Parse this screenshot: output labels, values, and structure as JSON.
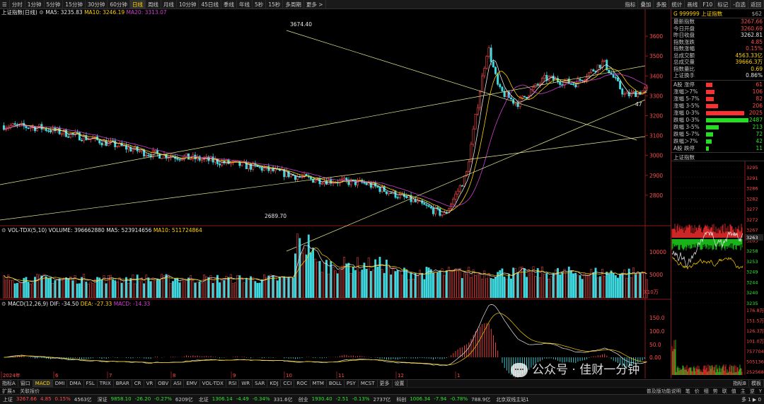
{
  "toolbar": {
    "left_items": [
      "分时",
      "1分钟",
      "5分钟",
      "15分钟",
      "30分钟",
      "60分钟",
      "日线",
      "周线",
      "月线",
      "10分钟",
      "45日线",
      "季线",
      "年线",
      "5秒",
      "15秒",
      "多周期",
      "更多 >"
    ],
    "active_index": 6,
    "right_items": [
      "指标",
      "叠加",
      "多股",
      "统计",
      "画线",
      "F10",
      "标记",
      "-自选",
      "返回"
    ]
  },
  "main_chart": {
    "title": "上证指数(日线)",
    "ma_labels": [
      {
        "text": "MA5: 3235.83",
        "color": "#e8e8e8"
      },
      {
        "text": "MA10: 3246.19",
        "color": "#ffd200"
      },
      {
        "text": "MA20: 3313.07",
        "color": "#d040d0"
      }
    ],
    "price_ticks": [
      "3600",
      "3500",
      "3400",
      "3300",
      "3200",
      "3100",
      "3000",
      "2900",
      "2800"
    ],
    "high_label": "3674.40",
    "low_label": "2689.70",
    "note_label": "47",
    "candles_up_color": "#ff4a4a",
    "candles_down_color": "#3fd9e0"
  },
  "volume_panel": {
    "title": "VOL-TDX(5,10)",
    "volume": "VOLUME: 396662880",
    "ma5": "MA5: 523914656",
    "ma10": "MA10: 511724864",
    "ticks": [
      "10000",
      "5000"
    ],
    "unit": "X10万"
  },
  "macd_panel": {
    "title": "MACD(12,26,9)",
    "dif": "DIF: -34.50",
    "dea": "DEA: -27.33",
    "macd": "MACD: -14.33",
    "ticks": [
      "150.0",
      "100.0",
      "50.0",
      "0.00"
    ],
    "months": [
      "2024年",
      "6",
      "7",
      "8",
      "9",
      "10",
      "11",
      "12",
      "1",
      "2"
    ]
  },
  "right_panel": {
    "header_code": "G 999999",
    "header_name": "上证指数",
    "header_tag": "$62",
    "quotes": [
      {
        "label": "最新指数",
        "value": "3267.66",
        "color": "red"
      },
      {
        "label": "今日开盘",
        "value": "3260.69",
        "color": "red"
      },
      {
        "label": "昨日收盘",
        "value": "3262.81",
        "color": "white"
      },
      {
        "label": "指数涨跌",
        "value": "4.85",
        "color": "red"
      },
      {
        "label": "指数涨幅",
        "value": "0.15%",
        "color": "red"
      },
      {
        "label": "总成交额",
        "value": "4563.33亿",
        "color": "yellow"
      },
      {
        "label": "总成交量",
        "value": "39666.3万",
        "color": "yellow"
      },
      {
        "label": "指数量比",
        "value": "0.69",
        "color": "yellow"
      },
      {
        "label": "上证换手",
        "value": "0.86%",
        "color": "white"
      }
    ],
    "breadth": [
      {
        "label": "A股 涨停",
        "value": "61",
        "count": 61,
        "color": "red"
      },
      {
        "label": "涨幅＞7%",
        "value": "106",
        "count": 106,
        "color": "red"
      },
      {
        "label": "涨幅 5-7%",
        "value": "82",
        "count": 82,
        "color": "red"
      },
      {
        "label": "涨幅 3-5%",
        "value": "206",
        "count": 206,
        "color": "red"
      },
      {
        "label": "涨幅 0-3%",
        "value": "2025",
        "count": 2025,
        "color": "red"
      },
      {
        "label": "跌幅 0-3%",
        "value": "2487",
        "count": 2487,
        "color": "green"
      },
      {
        "label": "跌幅 3-5%",
        "value": "213",
        "count": 213,
        "color": "green"
      },
      {
        "label": "跌幅 5-7%",
        "value": "72",
        "count": 72,
        "color": "green"
      },
      {
        "label": "跌幅＞7%",
        "value": "42",
        "count": 42,
        "color": "green"
      },
      {
        "label": "A股 跌停",
        "value": "11",
        "count": 11,
        "color": "green"
      }
    ],
    "intraday_title": "上证指数",
    "intraday_ticks": [
      "3295",
      "3291",
      "3286",
      "3282",
      "3277",
      "3272",
      "3267",
      "3263",
      "3258",
      "3253",
      "3249",
      "3244",
      "3240",
      "3235"
    ],
    "intraday_current": "3263",
    "intraday_vol_ticks": [
      "176.8万",
      "151.5万",
      "126.3万",
      "101.0万",
      "757704",
      "505136",
      "252568"
    ]
  },
  "indicator_tabs": {
    "items": [
      "指标A",
      "窗口",
      "MACD",
      "DMI",
      "DMA",
      "FSL",
      "TRIX",
      "BRAR",
      "CR",
      "VR",
      "OBV",
      "ASI",
      "EMV",
      "VOL-TDX",
      "RSI",
      "WR",
      "SAR",
      "KDJ",
      "CCI",
      "ROC",
      "MTM",
      "BOLL",
      "PSY",
      "MCST",
      "更多",
      "设置"
    ],
    "active_index": 2,
    "right_items": [
      "指标B",
      "模板"
    ]
  },
  "subtabs": {
    "left": [
      "扩展∧",
      "关联报价"
    ],
    "right": [
      "普及版功能说明",
      "笔",
      "价",
      "细",
      "势",
      "联",
      "值",
      "主",
      "逆",
      "Y"
    ]
  },
  "ticker": [
    {
      "name": "上证",
      "value": "3267.66",
      "change": "4.85",
      "pct": "0.15%",
      "amount": "4563亿",
      "color": "red"
    },
    {
      "name": "深证",
      "value": "9858.10",
      "change": "-26.20",
      "pct": "-0.27%",
      "amount": "6209亿",
      "color": "green"
    },
    {
      "name": "北证",
      "value": "1306.14",
      "change": "-4.49",
      "pct": "-0.34%",
      "amount": "331.6亿",
      "color": "green"
    },
    {
      "name": "创业",
      "value": "1930.40",
      "change": "-2.51",
      "pct": "-0.13%",
      "amount": "2737亿",
      "color": "green"
    },
    {
      "name": "科创",
      "value": "1006.34",
      "change": "-7.94",
      "pct": "-0.78%",
      "amount": "788.9亿",
      "color": "green"
    }
  ],
  "status": {
    "server": "北京双线主站1",
    "right": "多 1 ▶ 0"
  },
  "watermark": "公众号 · 佳财一分钟"
}
